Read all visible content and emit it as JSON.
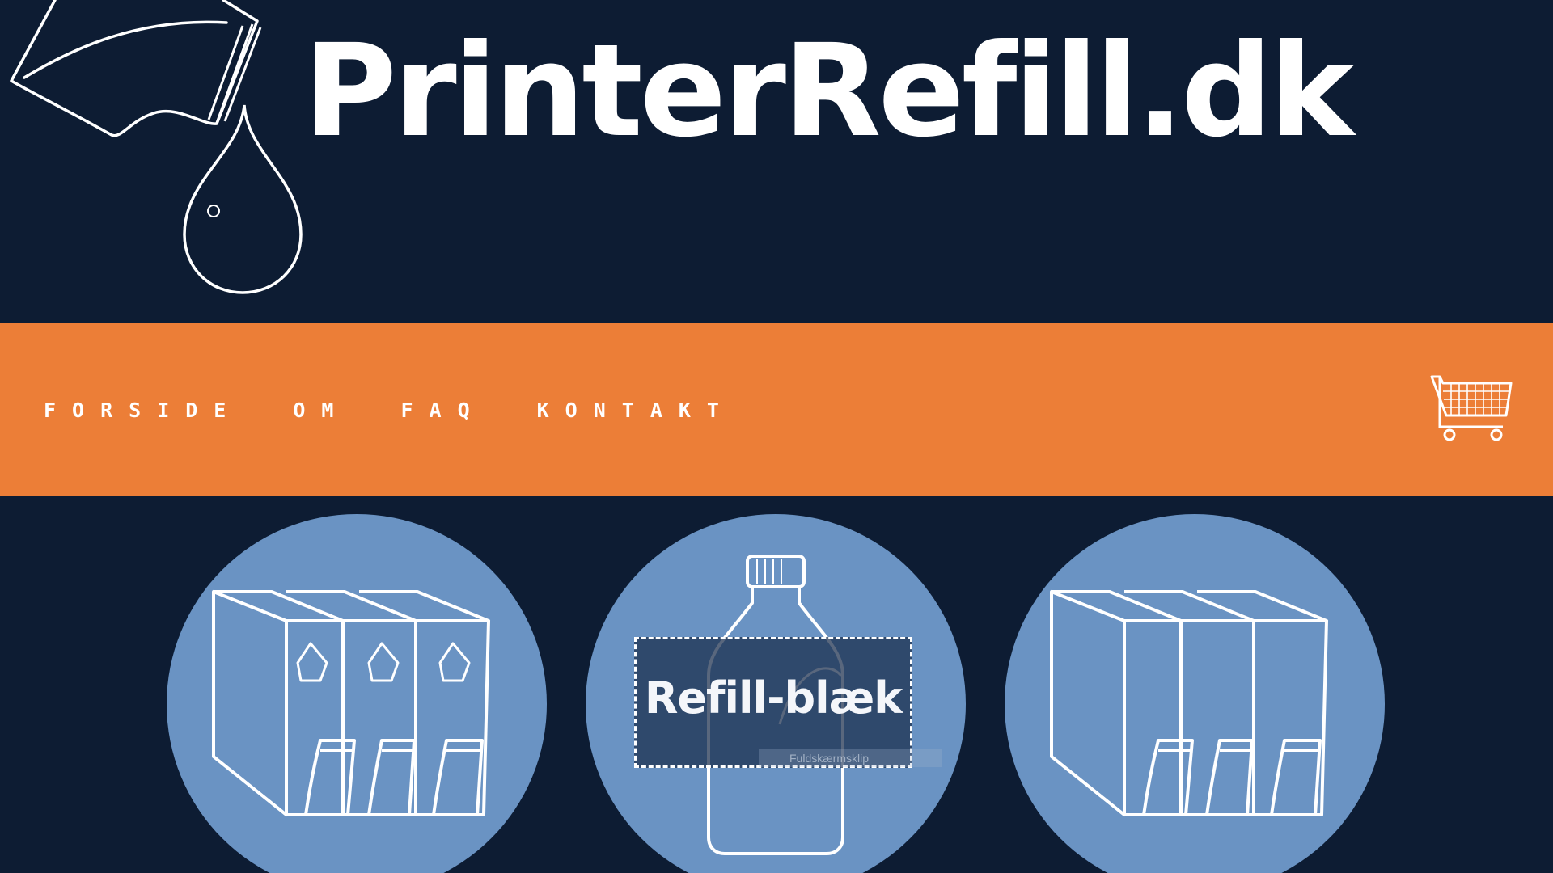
{
  "brand": {
    "title": "PrinterRefill.dk",
    "logo_icon": "ink-pouch-drop-icon"
  },
  "nav": {
    "items": [
      {
        "label": "FORSIDE"
      },
      {
        "label": "OM"
      },
      {
        "label": "FAQ"
      },
      {
        "label": "KONTAKT"
      }
    ],
    "cart_icon": "shopping-cart-icon"
  },
  "categories": [
    {
      "icon": "recycled-cartridges-icon"
    },
    {
      "label": "Refill-blæk",
      "icon": "ink-bottle-icon",
      "tooltip": "Fuldskærmsklip"
    },
    {
      "icon": "cartridges-icon"
    }
  ],
  "colors": {
    "background": "#0d1c33",
    "nav_bar": "#ec7e37",
    "circle": "#6a93c3",
    "text": "#ffffff"
  }
}
